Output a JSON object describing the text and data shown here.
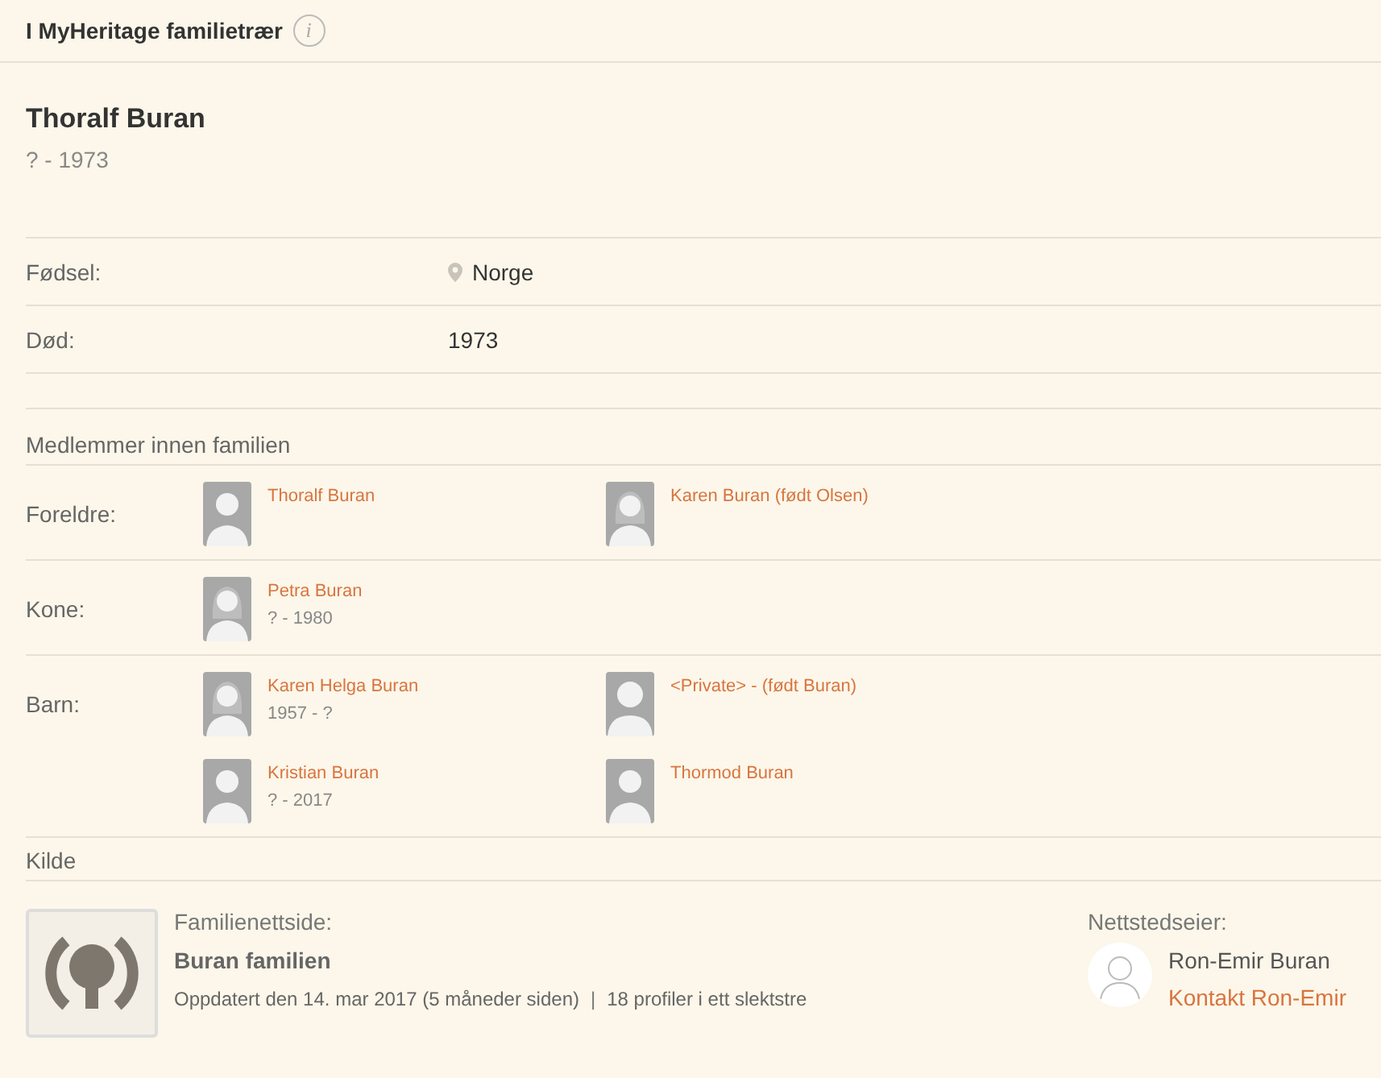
{
  "header": {
    "title": "I MyHeritage familietrær",
    "info_icon": "i"
  },
  "person": {
    "name": "Thoralf Buran",
    "dates": "? - 1973"
  },
  "facts": [
    {
      "label": "Fødsel:",
      "value": "Norge",
      "kind": "place"
    },
    {
      "label": "Død:",
      "value": "1973",
      "kind": "text"
    }
  ],
  "family": {
    "title": "Medlemmer innen familien",
    "groups": [
      {
        "label": "Foreldre:",
        "members": [
          {
            "name": "Thoralf Buran",
            "kind": "male"
          },
          {
            "name": "Karen Buran (født Olsen)",
            "kind": "female"
          }
        ]
      },
      {
        "label": "Kone:",
        "members": [
          {
            "name": "Petra Buran",
            "dates": "? - 1980",
            "kind": "female"
          }
        ]
      },
      {
        "label": "Barn:",
        "members": [
          {
            "name": "Karen Helga Buran",
            "dates": "1957 - ?",
            "kind": "female"
          },
          {
            "name": "<Private> - (født Buran)",
            "kind": "unknown"
          },
          {
            "name": "Kristian Buran",
            "dates": "? - 2017",
            "kind": "male"
          },
          {
            "name": "Thormod Buran",
            "kind": "male"
          }
        ]
      }
    ]
  },
  "source": {
    "title": "Kilde",
    "site_label": "Familienettside:",
    "site_name": "Buran familien",
    "updated": "Oppdatert den 14. mar 2017 (5 måneder siden)",
    "separator": "|",
    "profiles": "18 profiler i ett slektstre",
    "owner_label": "Nettstedseier:",
    "owner_name": "Ron-Emir Buran",
    "contact": "Kontakt Ron-Emir"
  }
}
